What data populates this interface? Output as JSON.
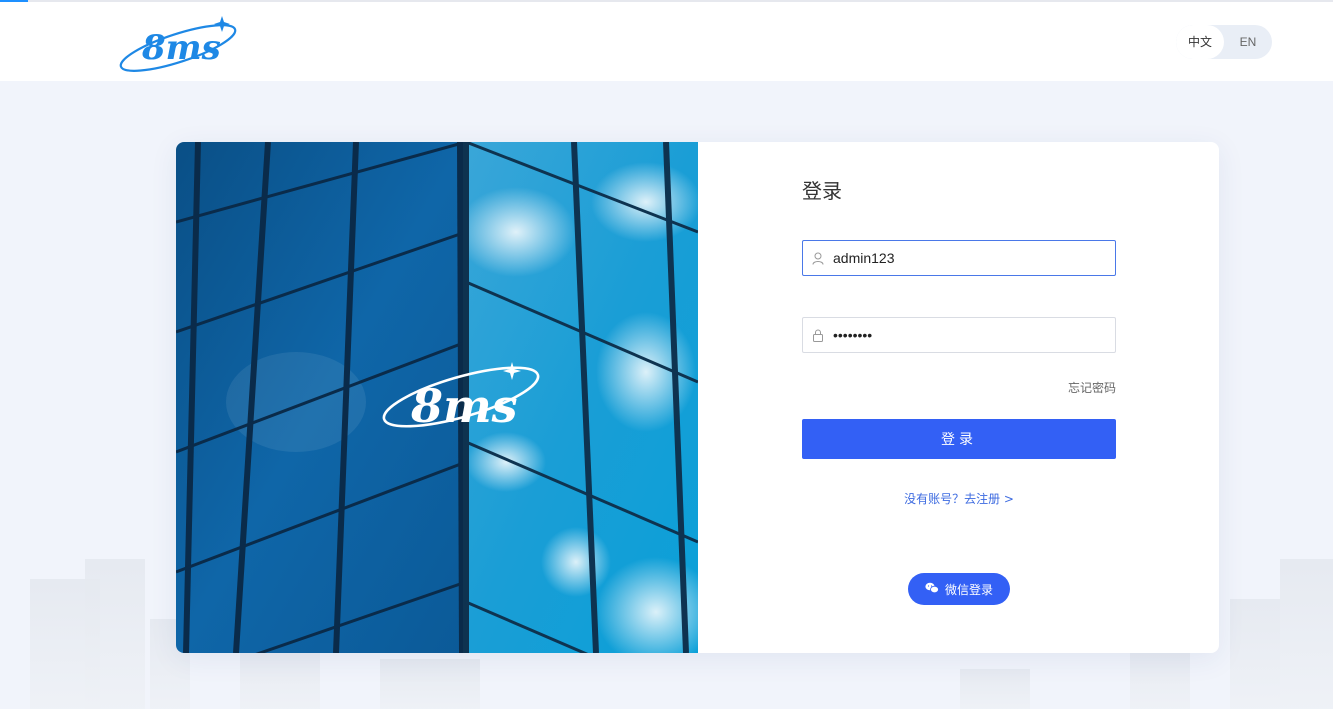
{
  "header": {
    "logo_text": "8ms",
    "lang": {
      "zh_label": "中文",
      "en_label": "EN",
      "active": "zh"
    }
  },
  "hero": {
    "logo_text": "8ms"
  },
  "login": {
    "title": "登录",
    "username": {
      "value": "admin123",
      "icon": "user-icon"
    },
    "password": {
      "value": "pass1234",
      "icon": "lock-icon"
    },
    "forgot_label": "忘记密码",
    "submit_label": "登录",
    "register_label": "没有账号？去注册 >",
    "wechat_label": "微信登录",
    "wechat_icon": "wechat-icon"
  },
  "colors": {
    "primary": "#3360f5",
    "link": "#3c6ae0",
    "page_bg": "#f1f4fb",
    "logo_blue": "#1e88e5"
  }
}
